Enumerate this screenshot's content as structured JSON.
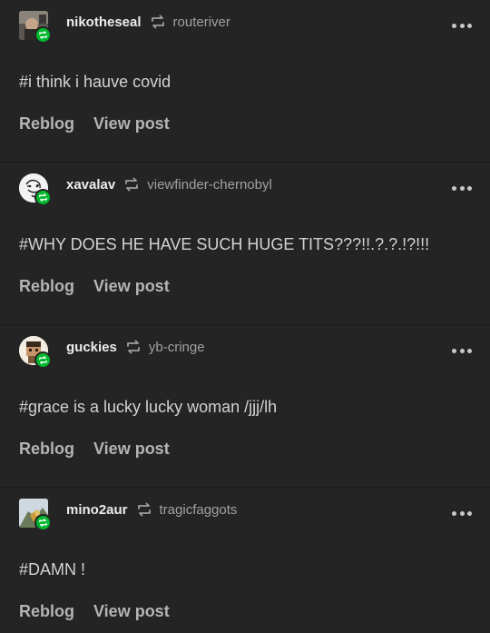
{
  "posts": [
    {
      "username": "nikotheseal",
      "source": "routeriver",
      "tag": "#i think i hauve covid",
      "reblog_label": "Reblog",
      "view_post_label": "View post",
      "avatar": "avatar-photo-dark"
    },
    {
      "username": "xavalav",
      "source": "viewfinder-chernobyl",
      "tag": "#WHY DOES HE HAVE SUCH HUGE TITS???!!.?.?.!?!!!",
      "reblog_label": "Reblog",
      "view_post_label": "View post",
      "avatar": "avatar-sketch-round"
    },
    {
      "username": "guckies",
      "source": "yb-cringe",
      "tag": "#grace is a lucky lucky woman /jjj/lh",
      "reblog_label": "Reblog",
      "view_post_label": "View post",
      "avatar": "avatar-pixel-round"
    },
    {
      "username": "mino2aur",
      "source": "tragicfaggots",
      "tag": "#DAMN !",
      "reblog_label": "Reblog",
      "view_post_label": "View post",
      "avatar": "avatar-photo-light"
    }
  ],
  "colors": {
    "background": "#242424",
    "badge_green": "#00b82e",
    "username": "#ececec",
    "source": "#a0a0a0",
    "tag_text": "#d2d2d2",
    "action_text": "#b4b4b4"
  }
}
